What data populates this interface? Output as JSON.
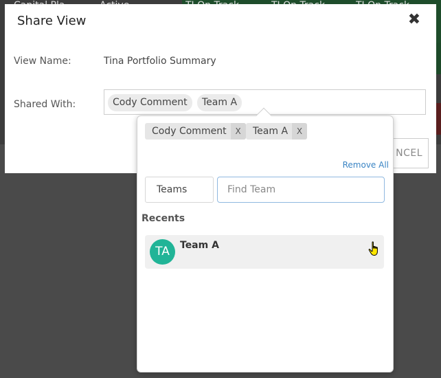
{
  "background": {
    "cells": [
      "Capital Pla...",
      "Active",
      "TI On Track",
      "TI On Track",
      "TI On Track"
    ]
  },
  "modal": {
    "title": "Share View",
    "close_icon": "close-icon",
    "view_name_label": "View Name:",
    "view_name_value": "Tina Portfolio Summary",
    "shared_with_label": "Shared With:",
    "shared_chips": [
      "Cody Comment",
      "Team A"
    ],
    "cancel_label": "NCEL"
  },
  "popover": {
    "selected": [
      {
        "label": "Cody Comment",
        "remove": "X"
      },
      {
        "label": "Team A",
        "remove": "X"
      }
    ],
    "remove_all": "Remove All",
    "type_select": "Teams",
    "find_placeholder": "Find Team",
    "recents_label": "Recents",
    "recents": [
      {
        "initials": "TA",
        "name": "Team A"
      }
    ]
  },
  "colors": {
    "avatar": "#21b497",
    "link": "#3a84c4",
    "input_focus_border": "#8fb8e0"
  }
}
